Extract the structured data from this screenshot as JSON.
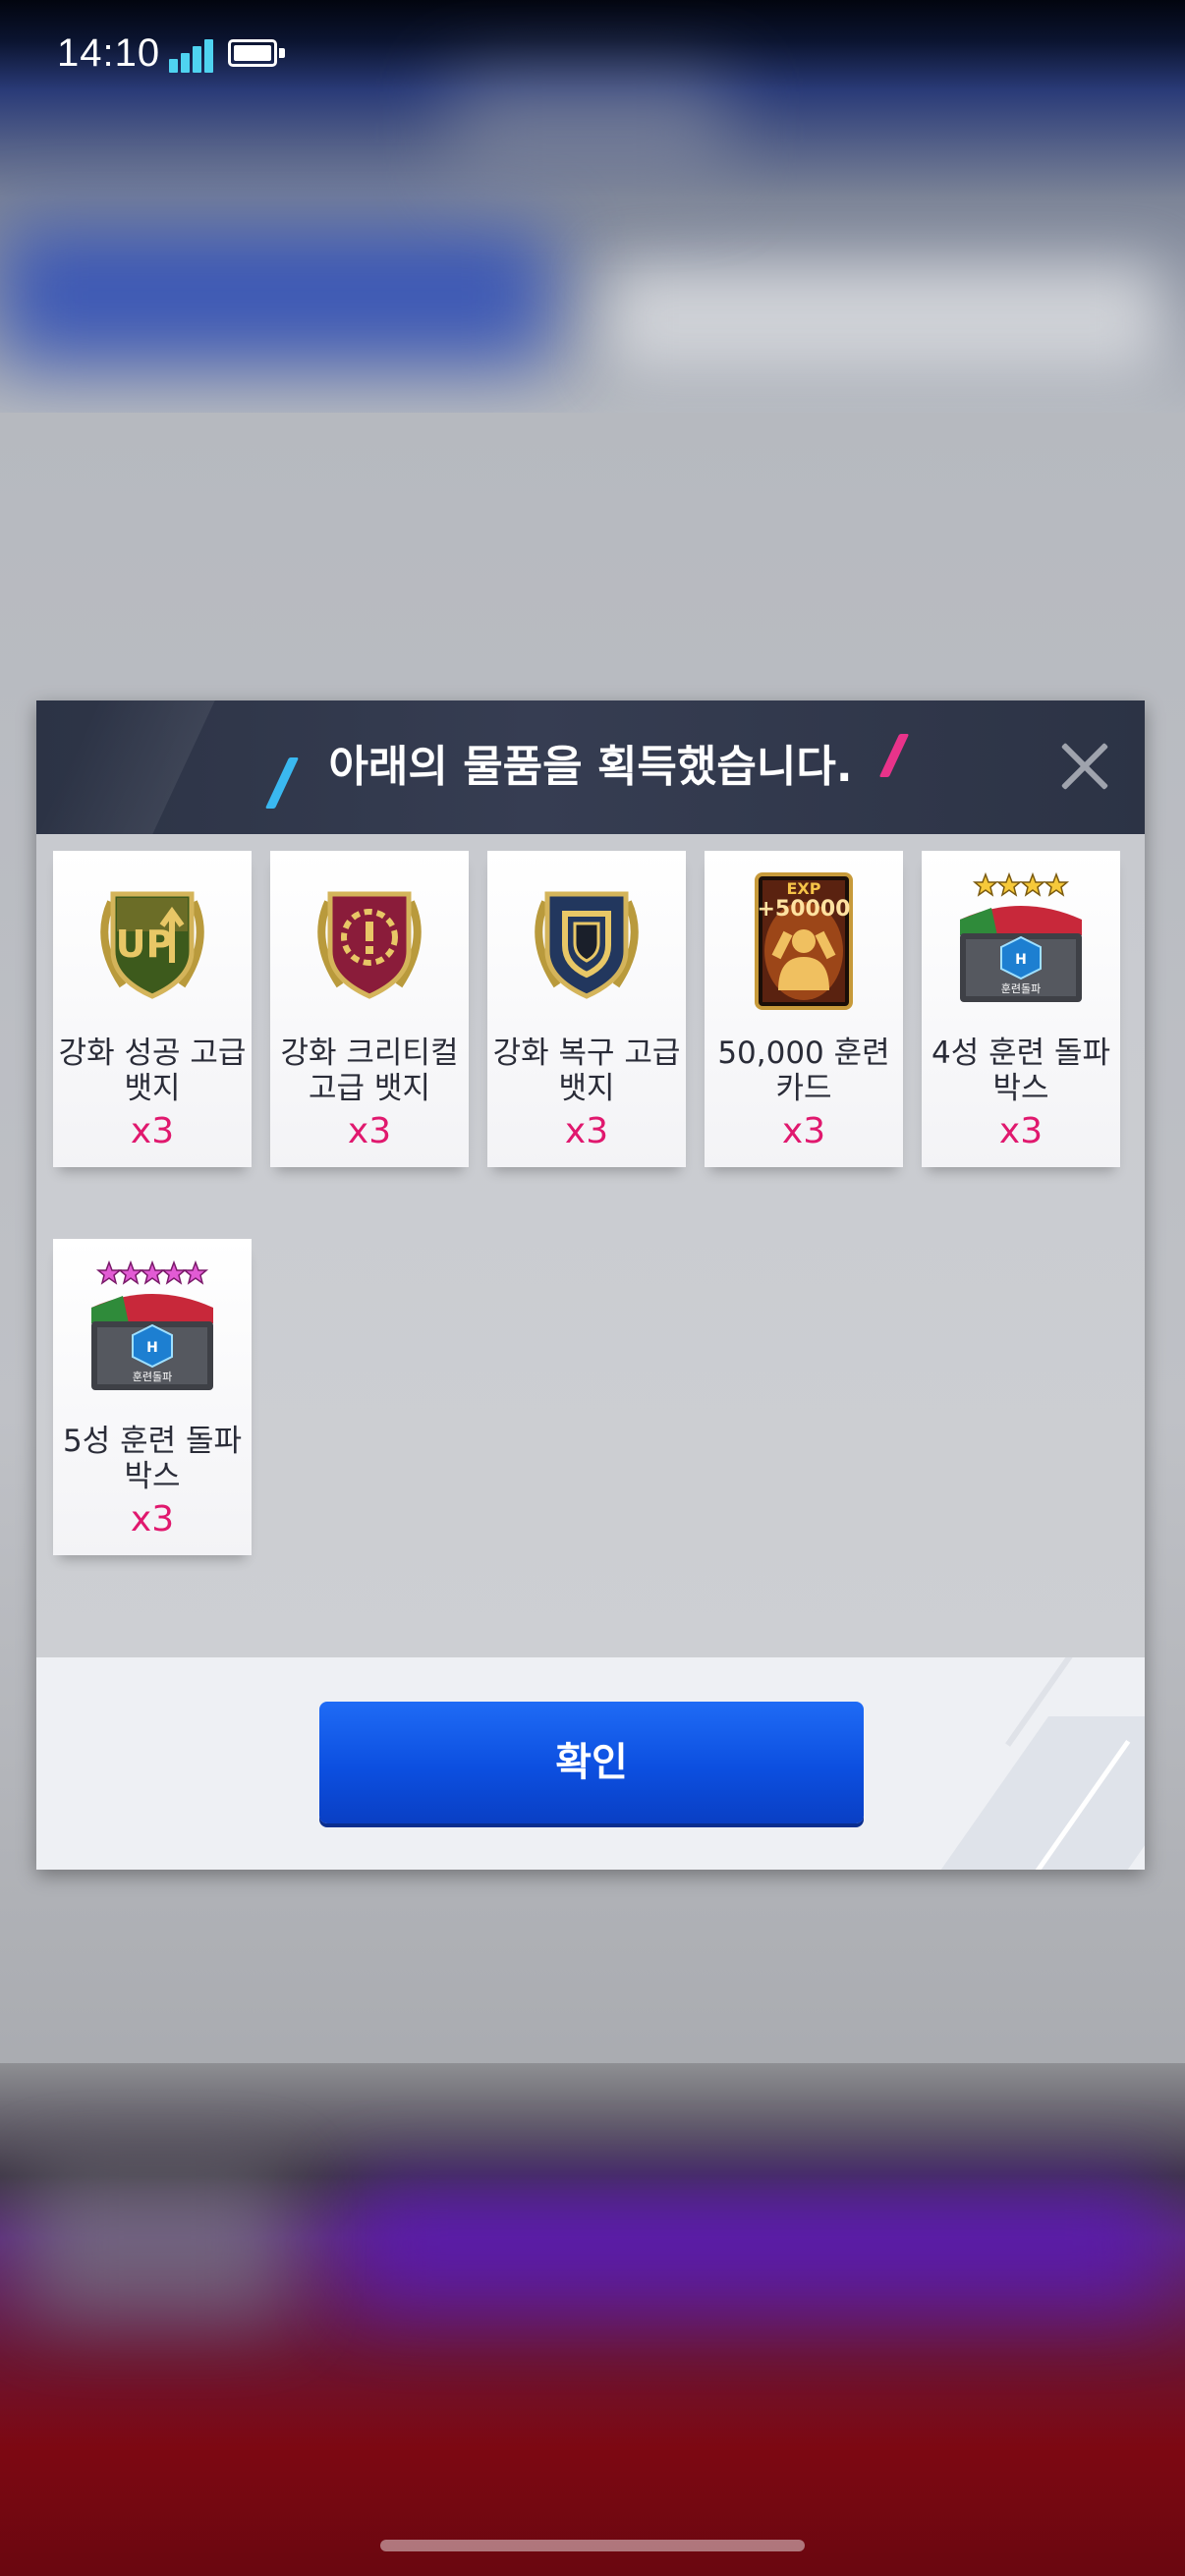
{
  "status_bar": {
    "time": "14:10",
    "signal_icon": "signal-bars-icon",
    "battery_icon": "battery-full-icon"
  },
  "dialog": {
    "title": "아래의 물품을 획득했습니다.",
    "close_icon": "close-icon",
    "items": [
      {
        "name": "강화 성공 고급\n뱃지",
        "qty": "x3",
        "icon": "upgrade-success-badge-icon"
      },
      {
        "name": "강화 크리티컬\n고급 뱃지",
        "qty": "x3",
        "icon": "critical-badge-icon"
      },
      {
        "name": "강화 복구 고급\n뱃지",
        "qty": "x3",
        "icon": "recovery-shield-badge-icon"
      },
      {
        "name": "50,000 훈련\n카드",
        "qty": "x3",
        "icon": "exp-training-card-icon",
        "card_text": "EXP",
        "card_value": "+50000"
      },
      {
        "name": "4성 훈련 돌파\n박스",
        "qty": "x3",
        "icon": "training-box-4star-icon",
        "box_label": "훈련돌파"
      },
      {
        "name": "5성 훈련 돌파\n박스",
        "qty": "x3",
        "icon": "training-box-5star-icon",
        "box_label": "훈련돌파"
      }
    ],
    "confirm_label": "확인"
  },
  "colors": {
    "accent_blue": "#3ab8f0",
    "accent_pink": "#e8338a",
    "qty_pink": "#e0186e",
    "button_blue": "#0c4fe0",
    "header_dark": "#2c3345"
  }
}
